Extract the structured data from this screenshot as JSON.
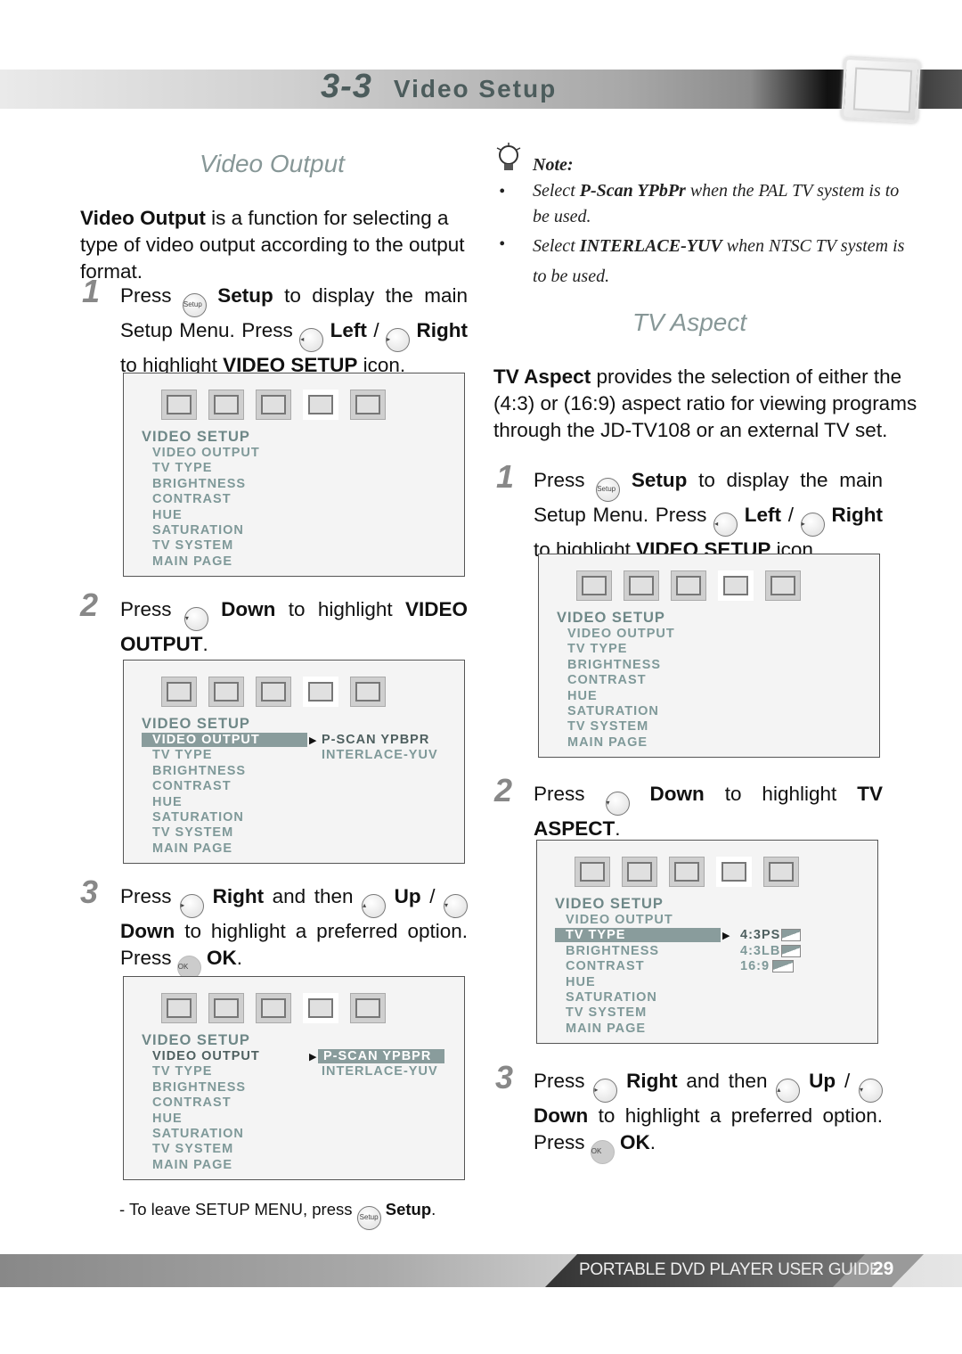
{
  "header": {
    "section_number": "3-3",
    "title": "Video Setup"
  },
  "left": {
    "heading": "Video Output",
    "intro": [
      {
        "b": "Video Output"
      },
      {
        "t": " is a function for selecting a type of video output according to the output format."
      }
    ],
    "steps": [
      {
        "num": "1",
        "segments": [
          {
            "t": "Press "
          },
          {
            "icon": "setup"
          },
          {
            "b": " Setup"
          },
          {
            "t": " to display the main Setup Menu. Press "
          },
          {
            "icon": "left"
          },
          {
            "b": " Left"
          },
          {
            "t": " / "
          },
          {
            "icon": "right"
          },
          {
            "b": " Right"
          },
          {
            "t": " to highlight "
          },
          {
            "b": "VIDEO SETUP"
          },
          {
            "t": " icon."
          }
        ]
      },
      {
        "num": "2",
        "segments": [
          {
            "t": "Press "
          },
          {
            "icon": "down"
          },
          {
            "b": " Down"
          },
          {
            "t": " to highlight "
          },
          {
            "b": "VIDEO OUTPUT"
          },
          {
            "t": "."
          }
        ]
      },
      {
        "num": "3",
        "segments": [
          {
            "t": "Press "
          },
          {
            "icon": "right"
          },
          {
            "b": " Right"
          },
          {
            "t": " and then "
          },
          {
            "icon": "up"
          },
          {
            "b": " Up"
          },
          {
            "t": " / "
          },
          {
            "icon": "down"
          },
          {
            "b": " Down"
          },
          {
            "t": " to highlight a preferred option. Press "
          },
          {
            "icon": "ok"
          },
          {
            "b": " OK"
          },
          {
            "t": "."
          }
        ]
      }
    ],
    "leave": [
      {
        "t": "- To leave SETUP MENU, press "
      },
      {
        "icon": "setup"
      },
      {
        "b": " Setup"
      },
      {
        "t": "."
      }
    ]
  },
  "right": {
    "note_label": "Note:",
    "notes": [
      [
        {
          "t": "Select "
        },
        {
          "b": "P-Scan YPbPr"
        },
        {
          "t": " when the PAL TV system is to be used."
        }
      ],
      [
        {
          "t": "Select "
        },
        {
          "b": "INTERLACE-YUV"
        },
        {
          "t": " when NTSC TV system is to be used."
        }
      ]
    ],
    "heading": "TV Aspect",
    "intro": [
      {
        "b": "TV Aspect"
      },
      {
        "t": " provides the selection of either the (4:3) or (16:9) aspect ratio for viewing programs through the JD-TV108 or an external TV set."
      }
    ],
    "steps": [
      {
        "num": "1",
        "segments": [
          {
            "t": "Press "
          },
          {
            "icon": "setup"
          },
          {
            "b": " Setup"
          },
          {
            "t": " to display the main Setup Menu. Press "
          },
          {
            "icon": "left"
          },
          {
            "b": " Left"
          },
          {
            "t": " / "
          },
          {
            "icon": "right"
          },
          {
            "b": " Right"
          },
          {
            "t": " to highlight "
          },
          {
            "b": "VIDEO SETUP"
          },
          {
            "t": " icon."
          }
        ]
      },
      {
        "num": "2",
        "segments": [
          {
            "t": "Press "
          },
          {
            "icon": "down"
          },
          {
            "b": " Down"
          },
          {
            "t": " to highlight "
          },
          {
            "b": "TV ASPECT"
          },
          {
            "t": "."
          }
        ]
      },
      {
        "num": "3",
        "segments": [
          {
            "t": "Press "
          },
          {
            "icon": "right"
          },
          {
            "b": " Right"
          },
          {
            "t": " and then "
          },
          {
            "icon": "up"
          },
          {
            "b": " Up"
          },
          {
            "t": " / "
          },
          {
            "icon": "down"
          },
          {
            "b": " Down"
          },
          {
            "t": " to highlight a preferred option. Press "
          },
          {
            "icon": "ok"
          },
          {
            "b": " OK"
          },
          {
            "t": "."
          }
        ]
      }
    ]
  },
  "button_labels": {
    "setup": "Setup",
    "ok": "OK",
    "left": "◂",
    "right": "▸",
    "up": "▴",
    "down": "▾"
  },
  "menu_icons": [
    "language-icon",
    "audio-icon",
    "speaker-icon",
    "video-camera-icon",
    "monitor-icon"
  ],
  "menus": [
    {
      "title": "VIDEO SETUP",
      "items": [
        "VIDEO OUTPUT",
        "TV TYPE",
        "BRIGHTNESS",
        "CONTRAST",
        "HUE",
        "SATURATION",
        "TV SYSTEM",
        "MAIN PAGE"
      ],
      "highlight": -1,
      "dark": -1,
      "options": [],
      "option_highlight": -1
    },
    {
      "title": "VIDEO SETUP",
      "items": [
        "VIDEO OUTPUT",
        "TV TYPE",
        "BRIGHTNESS",
        "CONTRAST",
        "HUE",
        "SATURATION",
        "TV SYSTEM",
        "MAIN PAGE"
      ],
      "highlight": 0,
      "dark": -1,
      "options": [
        "P-SCAN YPBPR",
        "INTERLACE-YUV"
      ],
      "option_highlight": -1,
      "option_dark": 0
    },
    {
      "title": "VIDEO SETUP",
      "items": [
        "VIDEO OUTPUT",
        "TV TYPE",
        "BRIGHTNESS",
        "CONTRAST",
        "HUE",
        "SATURATION",
        "TV SYSTEM",
        "MAIN PAGE"
      ],
      "highlight": -1,
      "dark": 0,
      "options": [
        "P-SCAN YPBPR",
        "INTERLACE-YUV"
      ],
      "option_highlight": 0,
      "option_dark": -1
    },
    {
      "title": "VIDEO SETUP",
      "items": [
        "VIDEO OUTPUT",
        "TV TYPE",
        "BRIGHTNESS",
        "CONTRAST",
        "HUE",
        "SATURATION",
        "TV SYSTEM",
        "MAIN PAGE"
      ],
      "highlight": -1,
      "dark": -1,
      "options": [],
      "option_highlight": -1
    },
    {
      "title": "VIDEO SETUP",
      "items": [
        "VIDEO OUTPUT",
        "TV TYPE",
        "BRIGHTNESS",
        "CONTRAST",
        "HUE",
        "SATURATION",
        "TV SYSTEM",
        "MAIN PAGE"
      ],
      "highlight": 1,
      "dark": -1,
      "options": [
        "4:3PS",
        "4:3LB",
        "16:9"
      ],
      "option_highlight": -1,
      "option_dark": 0,
      "aspect_icons": true
    }
  ],
  "footer": {
    "guide_title": "PORTABLE DVD PLAYER USER GUIDE",
    "page_number": "29"
  }
}
